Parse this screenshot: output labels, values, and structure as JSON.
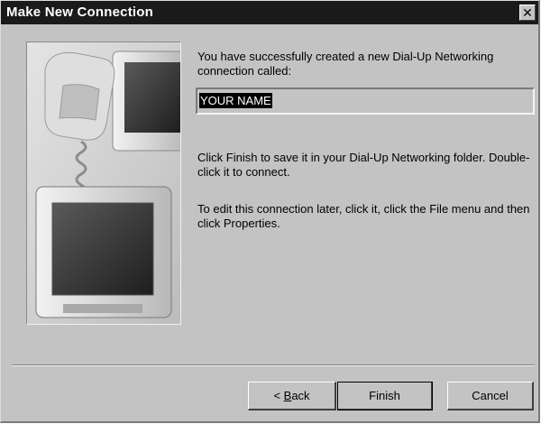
{
  "window": {
    "title": "Make New Connection",
    "close_glyph": "✕"
  },
  "illustration": {
    "icon": "computer-phone-illustration"
  },
  "content": {
    "message": "You have successfully created a new Dial-Up Networking connection called:",
    "connection_name": "YOUR NAME",
    "paragraph1": "Click Finish to save it in your Dial-Up Networking folder. Double-click it to connect.",
    "paragraph2": "To edit this connection later, click it, click the File menu and then click Properties."
  },
  "buttons": {
    "back_prefix": "< ",
    "back_accel": "B",
    "back_rest": "ack",
    "finish": "Finish",
    "cancel": "Cancel"
  },
  "colors": {
    "titlebar": "#1a1a1a",
    "face": "#c3c3c3"
  }
}
